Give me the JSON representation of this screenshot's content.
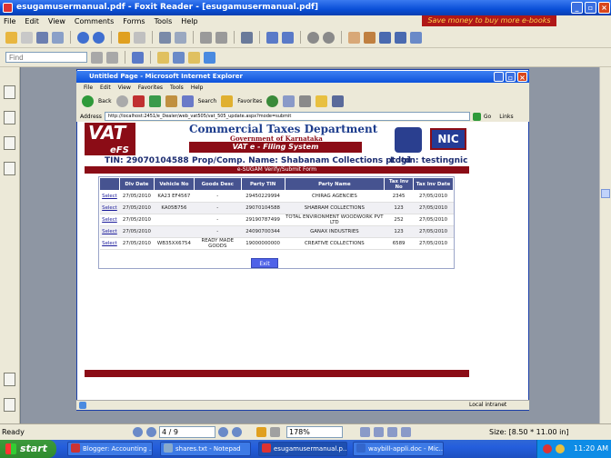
{
  "foxit": {
    "title": "esugamusermanual.pdf - Foxit Reader - [esugamusermanual.pdf]",
    "menu": [
      "File",
      "Edit",
      "View",
      "Comments",
      "Forms",
      "Tools",
      "Help"
    ],
    "ad_text": "Save money to buy more e-books",
    "find_placeholder": "Find",
    "status_ready": "Ready",
    "page_current": "4 / 9",
    "zoom": "178%",
    "page_size": "Size: [8.50 * 11.00 in]"
  },
  "ie": {
    "title": "Untitled Page - Microsoft Internet Explorer",
    "menu": [
      "File",
      "Edit",
      "View",
      "Favorites",
      "Tools",
      "Help"
    ],
    "back_label": "Back",
    "search_label": "Search",
    "favorites_label": "Favorites",
    "address_label": "Address",
    "url": "http://localhost:2451/e_Dealer/web_vat505/vat_505_update.aspx?mode=submit",
    "go_label": "Go",
    "links_label": "Links",
    "zone": "Local intranet"
  },
  "webpage": {
    "logo_vat": "VAT",
    "logo_efs": "eFS",
    "dept": "Commercial Taxes Department",
    "gov": "Government of Karnataka",
    "vat_efiling": "VAT e - Filing System",
    "nic": "NIC",
    "tin": "TIN: 29070104588",
    "prop_name": "Prop/Comp. Name: Shabanam Collections pt ltd",
    "login": "Login: testingnic",
    "form_title": "e-SUGAM Verify/Submit Form",
    "columns": [
      "",
      "Dlv Date",
      "Vehicle No",
      "Goods Desc",
      "Party TIN",
      "Party Name",
      "Tax Inv No",
      "Tax Inv Date"
    ],
    "rows": [
      [
        "Select",
        "27/05/2010",
        "KA23 EF4567",
        "-",
        "29450229994",
        "CHIRAG AGENCIES",
        "2345",
        "27/05/2010"
      ],
      [
        "Select",
        "27/05/2010",
        "KA05B756",
        "-",
        "29070104588",
        "SHABRAM COLLECTIONS",
        "123",
        "27/05/2010"
      ],
      [
        "Select",
        "27/05/2010",
        "",
        "-",
        "29190787499",
        "TOTAL ENVIRONMENT WOODWORK PVT LTD",
        "252",
        "27/05/2010"
      ],
      [
        "Select",
        "27/05/2010",
        "",
        "-",
        "24090700344",
        "GANAX INDUSTRIES",
        "123",
        "27/05/2010"
      ],
      [
        "Select",
        "27/05/2010",
        "WB35XX6754",
        "READY MADE GOODS",
        "19000000000",
        "CREATIVE COLLECTIONS",
        "6589",
        "27/05/2010"
      ]
    ],
    "exit_label": "Exit"
  },
  "taskbar": {
    "start": "start",
    "tasks": [
      "Blogger: Accounting ...",
      "shares.txt - Notepad",
      "esugamusermanual.p...",
      "waybill-appli.doc - Mic..."
    ],
    "clock": "11:20 AM"
  }
}
